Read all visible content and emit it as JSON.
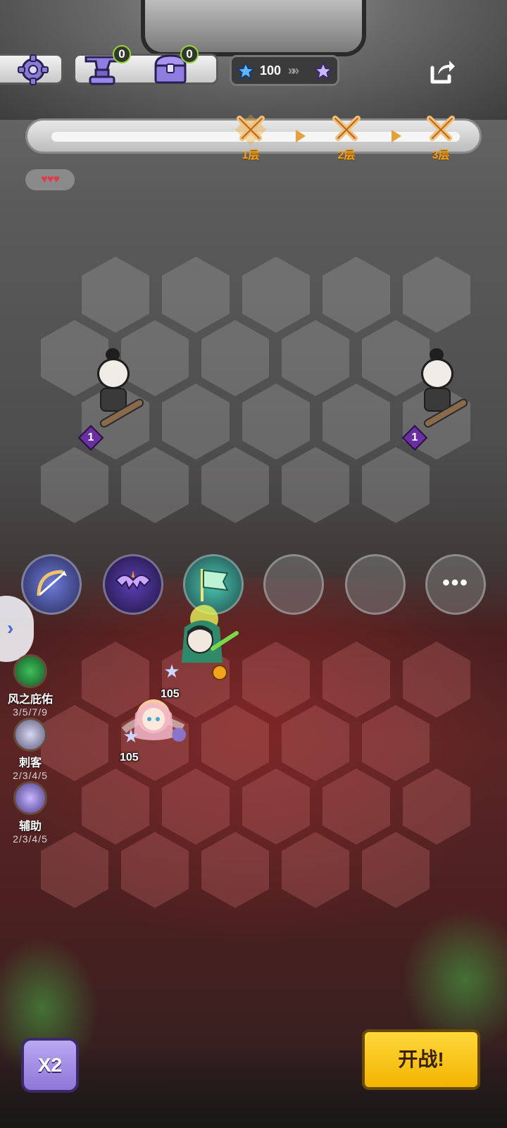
{
  "topbar": {
    "anvil_count": "0",
    "chest_count": "0",
    "star_count": "100",
    "chevrons": "»»"
  },
  "progress": {
    "stages": [
      {
        "label": "1层",
        "active": true
      },
      {
        "label": "2层",
        "active": false
      },
      {
        "label": "3层",
        "active": false
      }
    ]
  },
  "lives": {
    "hearts": "♥♥♥"
  },
  "enemies": [
    {
      "level": "1"
    },
    {
      "level": "1"
    }
  ],
  "skill_slots": {
    "more_label": "•••"
  },
  "synergies": [
    {
      "name": "风之庇佑",
      "steps": "3/5/7/9"
    },
    {
      "name": "刺客",
      "steps": "2/3/4/5"
    },
    {
      "name": "辅助",
      "steps": "2/3/4/5"
    }
  ],
  "units": [
    {
      "level": "105"
    },
    {
      "level": "105"
    }
  ],
  "buttons": {
    "speed": "X2",
    "start": "开战!"
  },
  "colors": {
    "accent_gold": "#f3a21b",
    "fight_yellow": "#ffd83a",
    "speed_purple": "#8f76d8"
  }
}
